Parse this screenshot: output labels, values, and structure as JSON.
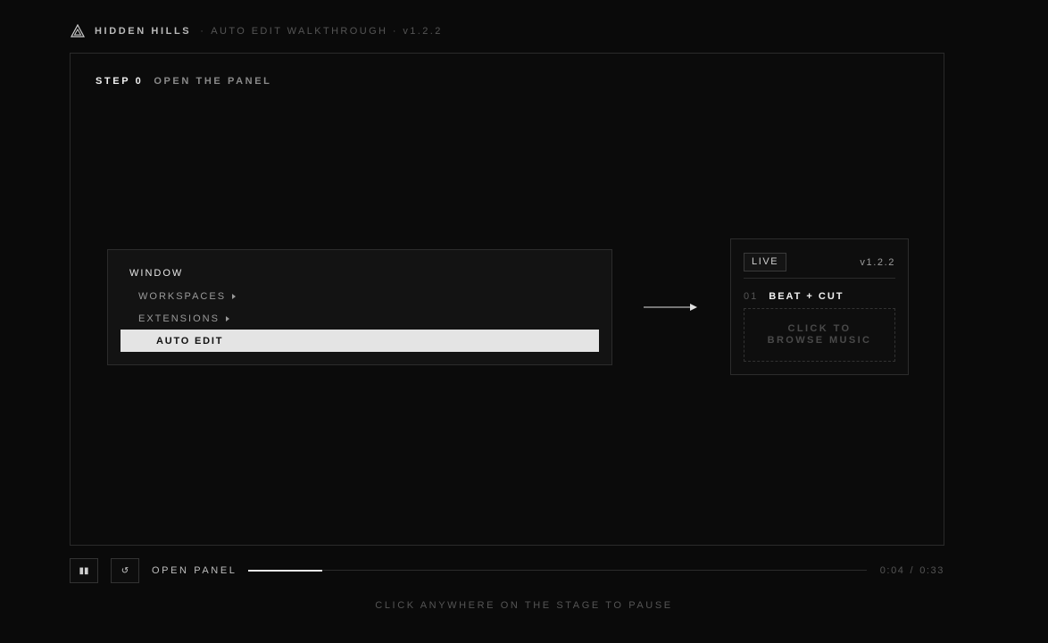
{
  "header": {
    "brand": "HIDDEN HILLS",
    "separator": "·",
    "subtitle": "AUTO EDIT WALKTHROUGH · v1.2.2",
    "logo_icon": "triangle-logo-icon"
  },
  "stage": {
    "step_number": "STEP 0",
    "step_title": "OPEN THE PANEL",
    "menu": {
      "heading": "WINDOW",
      "items": [
        {
          "label": "WORKSPACES",
          "icon": "caret-right-icon"
        },
        {
          "label": "EXTENSIONS",
          "icon": "caret-right-icon"
        }
      ],
      "active_item": "AUTO EDIT"
    },
    "arrow_icon": "arrow-right-icon",
    "panel": {
      "badge": "LIVE",
      "version": "v1.2.2",
      "track_number": "01",
      "track_name": "BEAT + CUT",
      "browse_label": "CLICK TO BROWSE MUSIC"
    }
  },
  "controls": {
    "pause_icon": "pause-icon",
    "pause_glyph": "▮▮",
    "restart_icon": "restart-icon",
    "restart_glyph": "↺",
    "label": "OPEN PANEL",
    "progress_fraction": 0.12,
    "time_current": "0:04",
    "time_separator": "/",
    "time_total": "0:33"
  },
  "hint": "CLICK ANYWHERE ON THE STAGE TO PAUSE",
  "colors": {
    "background": "#0a0a0a",
    "accent": "#e4e4e4",
    "muted": "#555555"
  }
}
